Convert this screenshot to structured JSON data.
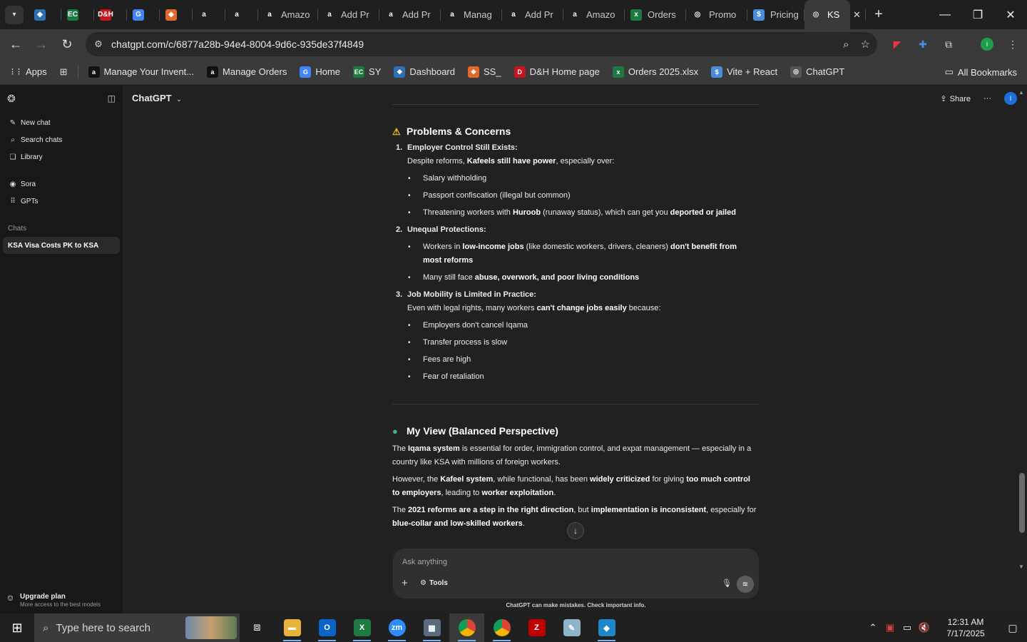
{
  "browser": {
    "tabs": [
      {
        "label": "",
        "color": "#2d6fb3",
        "glyph": "◆"
      },
      {
        "label": "",
        "color": "#1b7a3e",
        "glyph": "EC"
      },
      {
        "label": "",
        "color": "#c4161c",
        "glyph": "D&H"
      },
      {
        "label": "",
        "color": "#4285f4",
        "glyph": "G"
      },
      {
        "label": "",
        "color": "#e06a2b",
        "glyph": "◈"
      },
      {
        "label": "",
        "color": "#ffffff",
        "glyph": "a"
      },
      {
        "label": "",
        "color": "#ffffff",
        "glyph": "a"
      },
      {
        "label": "Amazo",
        "color": "#ffffff",
        "glyph": "a"
      },
      {
        "label": "Add Pr",
        "color": "#ffffff",
        "glyph": "a"
      },
      {
        "label": "Add Pr",
        "color": "#ffffff",
        "glyph": "a"
      },
      {
        "label": "Manag",
        "color": "#ffffff",
        "glyph": "a"
      },
      {
        "label": "Add Pr",
        "color": "#ffffff",
        "glyph": "a"
      },
      {
        "label": "Amazo",
        "color": "#ffffff",
        "glyph": "a"
      },
      {
        "label": "Orders",
        "color": "#1d7a43",
        "glyph": "x"
      },
      {
        "label": "Promo",
        "color": "#ffffff",
        "glyph": "◎"
      },
      {
        "label": "Pricing",
        "color": "#4a8cd8",
        "glyph": "$"
      }
    ],
    "active_tab": {
      "label": "KS",
      "glyph": "◎"
    },
    "url": "chatgpt.com/c/6877a28b-94e4-8004-9d6c-935de37f4849",
    "bookmarks": [
      {
        "label": "Apps",
        "glyph": "⋮⋮",
        "color": "#3a3a3a"
      },
      {
        "label": "Manage Your Invent...",
        "glyph": "a",
        "color": "#111111"
      },
      {
        "label": "Manage Orders",
        "glyph": "a",
        "color": "#111111"
      },
      {
        "label": "Home",
        "glyph": "G",
        "color": "#4285f4"
      },
      {
        "label": "SY",
        "glyph": "EC",
        "color": "#1b7a3e"
      },
      {
        "label": "Dashboard",
        "glyph": "◆",
        "color": "#2d6fb3"
      },
      {
        "label": "SS_",
        "glyph": "◈",
        "color": "#e06a2b"
      },
      {
        "label": "D&H Home page",
        "glyph": "D",
        "color": "#c4161c"
      },
      {
        "label": "Orders 2025.xlsx",
        "glyph": "x",
        "color": "#1d7a43"
      },
      {
        "label": "Vite + React",
        "glyph": "$",
        "color": "#4a8cd8"
      },
      {
        "label": "ChatGPT",
        "glyph": "◎",
        "color": "#555555"
      }
    ],
    "all_bookmarks": "All Bookmarks"
  },
  "sidebar": {
    "items": [
      {
        "label": "New chat",
        "icon": "✎"
      },
      {
        "label": "Search chats",
        "icon": "⌕"
      },
      {
        "label": "Library",
        "icon": "❏"
      }
    ],
    "items2": [
      {
        "label": "Sora",
        "icon": "◉"
      },
      {
        "label": "GPTs",
        "icon": "⠿"
      }
    ],
    "chats_label": "Chats",
    "active_chat": "KSA Visa Costs PK to KSA",
    "upgrade_title": "Upgrade plan",
    "upgrade_sub": "More access to the best models"
  },
  "header": {
    "model": "ChatGPT",
    "share": "Share",
    "avatar": "I"
  },
  "content": {
    "problems_heading": "Problems & Concerns",
    "p1_num": "1.",
    "p1_title": "Employer Control Still Exists:",
    "p1_desc_a": "Despite reforms, ",
    "p1_desc_b": "Kafeels still have power",
    "p1_desc_c": ", especially over:",
    "p1_b1": "Salary withholding",
    "p1_b2": "Passport confiscation (illegal but common)",
    "p1_b3a": "Threatening workers with ",
    "p1_b3b": "Huroob",
    "p1_b3c": " (runaway status), which can get you ",
    "p1_b3d": "deported or jailed",
    "p2_num": "2.",
    "p2_title": "Unequal Protections:",
    "p2_b1a": "Workers in ",
    "p2_b1b": "low-income jobs",
    "p2_b1c": " (like domestic workers, drivers, cleaners) ",
    "p2_b1d": "don't benefit from most reforms",
    "p2_b2a": "Many still face ",
    "p2_b2b": "abuse, overwork, and poor living conditions",
    "p3_num": "3.",
    "p3_title": "Job Mobility is Limited in Practice:",
    "p3_desc_a": "Even with legal rights, many workers ",
    "p3_desc_b": "can't change jobs easily",
    "p3_desc_c": " because:",
    "p3_b1": "Employers don't cancel Iqama",
    "p3_b2": "Transfer process is slow",
    "p3_b3": "Fees are high",
    "p3_b4": "Fear of retaliation",
    "view_heading": "My View (Balanced Perspective)",
    "v1a": "The ",
    "v1b": "Iqama system",
    "v1c": " is essential for order, immigration control, and expat management — especially in a country like KSA with millions of foreign workers.",
    "v2a": "However, the ",
    "v2b": "Kafeel system",
    "v2c": ", while functional, has been ",
    "v2d": "widely criticized",
    "v2e": " for giving ",
    "v2f": "too much control to employers",
    "v2g": ", leading to ",
    "v2h": "worker exploitation",
    "v2i": ".",
    "v3a": "The ",
    "v3b": "2021 reforms are a step in the right direction",
    "v3c": ", but ",
    "v3d": "implementation is inconsistent",
    "v3e": ", especially for ",
    "v3f": "blue-collar and low-skilled workers",
    "v3g": "."
  },
  "composer": {
    "placeholder": "Ask anything",
    "tools": "Tools",
    "disclaimer": "ChatGPT can make mistakes. Check important info."
  },
  "taskbar": {
    "search_placeholder": "Type here to search",
    "time": "12:31 AM",
    "date": "7/17/2025"
  }
}
